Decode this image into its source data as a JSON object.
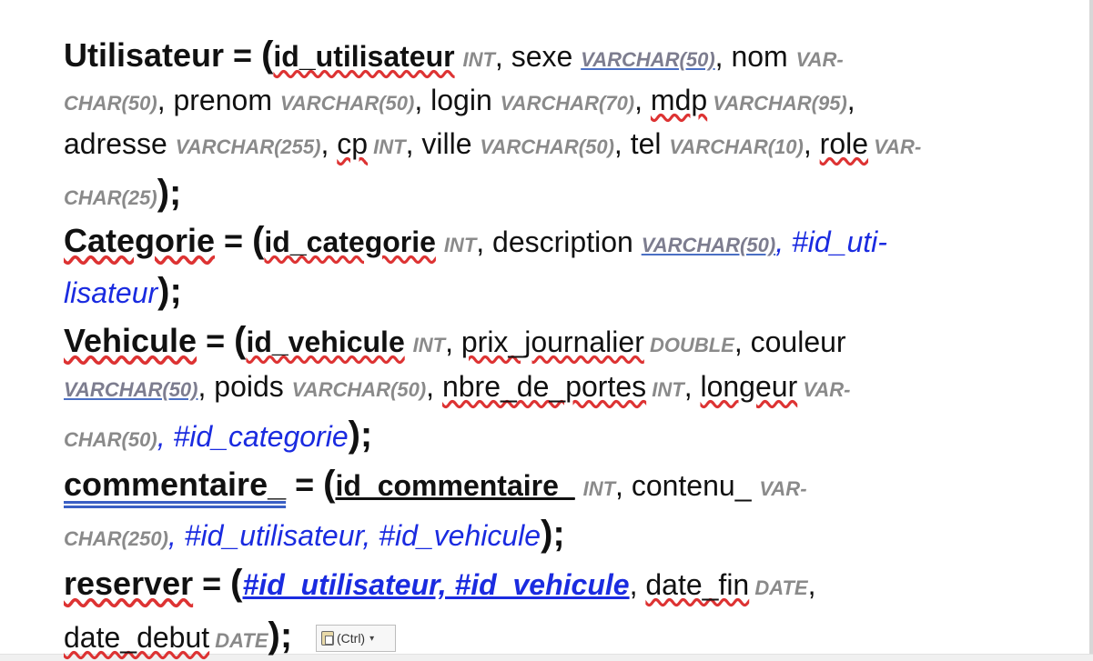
{
  "doc": {
    "utilisateur": {
      "entity": "Utilisateur",
      "eq": " = ",
      "open": "(",
      "pk": "id_utilisateur",
      "pk_type": "INT",
      "a_sexe": ", sexe ",
      "t_sexe": "VARCHAR(50)",
      "a_nom": ", nom ",
      "t_nom_1": "VAR-",
      "t_nom_2": "CHAR(50)",
      "a_prenom": ", prenom ",
      "t_prenom": "VARCHAR(50)",
      "a_login": ", login ",
      "t_login": "VARCHAR(70)",
      "sep_mdp": ", ",
      "a_mdp": "mdp",
      "t_mdp": " VARCHAR(95)",
      "end_line2": ",",
      "a_adresse": "adresse ",
      "t_adresse": "VARCHAR(255)",
      "sep_cp": ", ",
      "a_cp": "cp",
      "t_cp": " INT",
      "a_ville": ", ville ",
      "t_ville": "VARCHAR(50)",
      "a_tel": ", tel ",
      "t_tel": "VARCHAR(10)",
      "sep_role": ", ",
      "a_role": "role",
      "t_role_1": " VAR-",
      "t_role_2": "CHAR(25)",
      "close": ");"
    },
    "categorie": {
      "entity": "Categorie",
      "eq": " = ",
      "open": "(",
      "pk": "id_categorie",
      "pk_type": "INT",
      "a_description": ", description ",
      "t_description": "VARCHAR(50)",
      "fk_1": ", #id_uti-",
      "fk_2": "lisateur",
      "close": ");"
    },
    "vehicule": {
      "entity": "Vehicule",
      "eq": " = ",
      "open": "(",
      "pk": "id_vehicule",
      "pk_type": "INT",
      "sep_prix": ", ",
      "a_prix": "prix_journalier",
      "t_prix": " DOUBLE",
      "a_couleur": ", couleur",
      "t_couleur": "VARCHAR(50)",
      "a_poids": ", poids ",
      "t_poids": "VARCHAR(50)",
      "sep_portes": ", ",
      "a_portes": "nbre_de_portes",
      "t_portes": " INT",
      "sep_longeur": ", ",
      "a_longeur": "longeur",
      "t_longeur_1": " VAR-",
      "t_longeur_2": "CHAR(50)",
      "fk": ", #id_categorie",
      "close": ");"
    },
    "commentaire": {
      "entity": "commentaire_",
      "eq": " = ",
      "open": "(",
      "pk": "id_commentaire_",
      "pk_type": "INT",
      "a_contenu": ", contenu_ ",
      "t_contenu_1": "VAR-",
      "t_contenu_2": "CHAR(250)",
      "fk": ", #id_utilisateur, #id_vehicule",
      "close": ");"
    },
    "reserver": {
      "entity": "reserver",
      "eq": " = ",
      "open": "(",
      "pk_fk": "#id_utilisateur, #id_vehicule",
      "sep_fin": ", ",
      "a_date_fin": "date_fin",
      "t_date_fin": " DATE",
      "end": ",",
      "a_date_debut": "date_debut",
      "t_date_debut": " DATE",
      "close": ");"
    }
  },
  "paste_options": {
    "label": "(Ctrl)",
    "icon": "clipboard-icon",
    "caret_icon": "dropdown-caret-icon"
  }
}
